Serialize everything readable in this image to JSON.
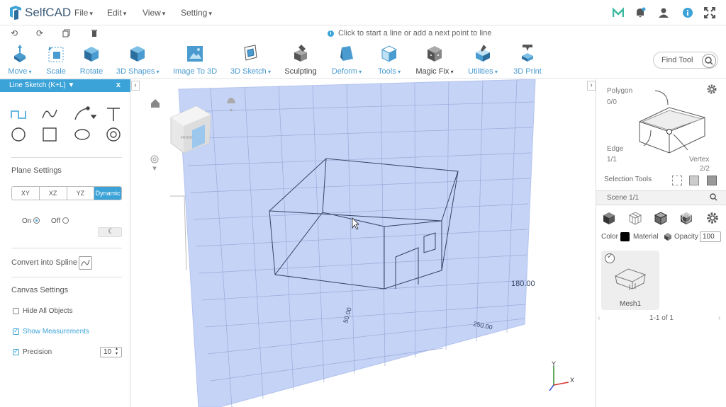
{
  "app": {
    "name": "SelfCAD"
  },
  "menu": {
    "file": "File",
    "edit": "Edit",
    "view": "View",
    "setting": "Setting"
  },
  "hint": "Click to start a line or add a next point to line",
  "tools": {
    "move": "Move",
    "scale": "Scale",
    "rotate": "Rotate",
    "shapes3d": "3D Shapes",
    "image3d": "Image To 3D",
    "sketch3d": "3D Sketch",
    "sculpting": "Sculpting",
    "deform": "Deform",
    "tools": "Tools",
    "magicfix": "Magic Fix",
    "utilities": "Utilities",
    "print3d": "3D Print"
  },
  "find_tool": "Find Tool",
  "left_panel": {
    "title": "Line Sketch (K+L)",
    "plane_settings": "Plane Settings",
    "planes": [
      "XY",
      "XZ",
      "YZ",
      "Dynamic"
    ],
    "on": "On",
    "off": "Off",
    "convert_spline": "Convert into Spline",
    "canvas_settings": "Canvas Settings",
    "hide_all": "Hide All Objects",
    "show_measurements": "Show Measurements",
    "precision": "Precision",
    "precision_value": "10"
  },
  "canvas": {
    "cube_label": "FRONT",
    "measure_180": "180.00",
    "measure_250": "250.00",
    "measure_50": "50.00",
    "axis_x": "X",
    "axis_y": "Y"
  },
  "right_panel": {
    "polygon": "Polygon",
    "polygon_count": "0/0",
    "edge": "Edge",
    "edge_count": "1/1",
    "vertex": "Vertex",
    "vertex_count": "2/2",
    "selection_tools": "Selection Tools",
    "scene": "Scene 1/1",
    "color": "Color",
    "material": "Material",
    "opacity": "Opacity",
    "opacity_value": "100",
    "mesh_name": "Mesh1",
    "pager": "1-1 of 1"
  },
  "colors": {
    "accent": "#3ba3d8",
    "grid_plane": "#c5d3f7"
  }
}
